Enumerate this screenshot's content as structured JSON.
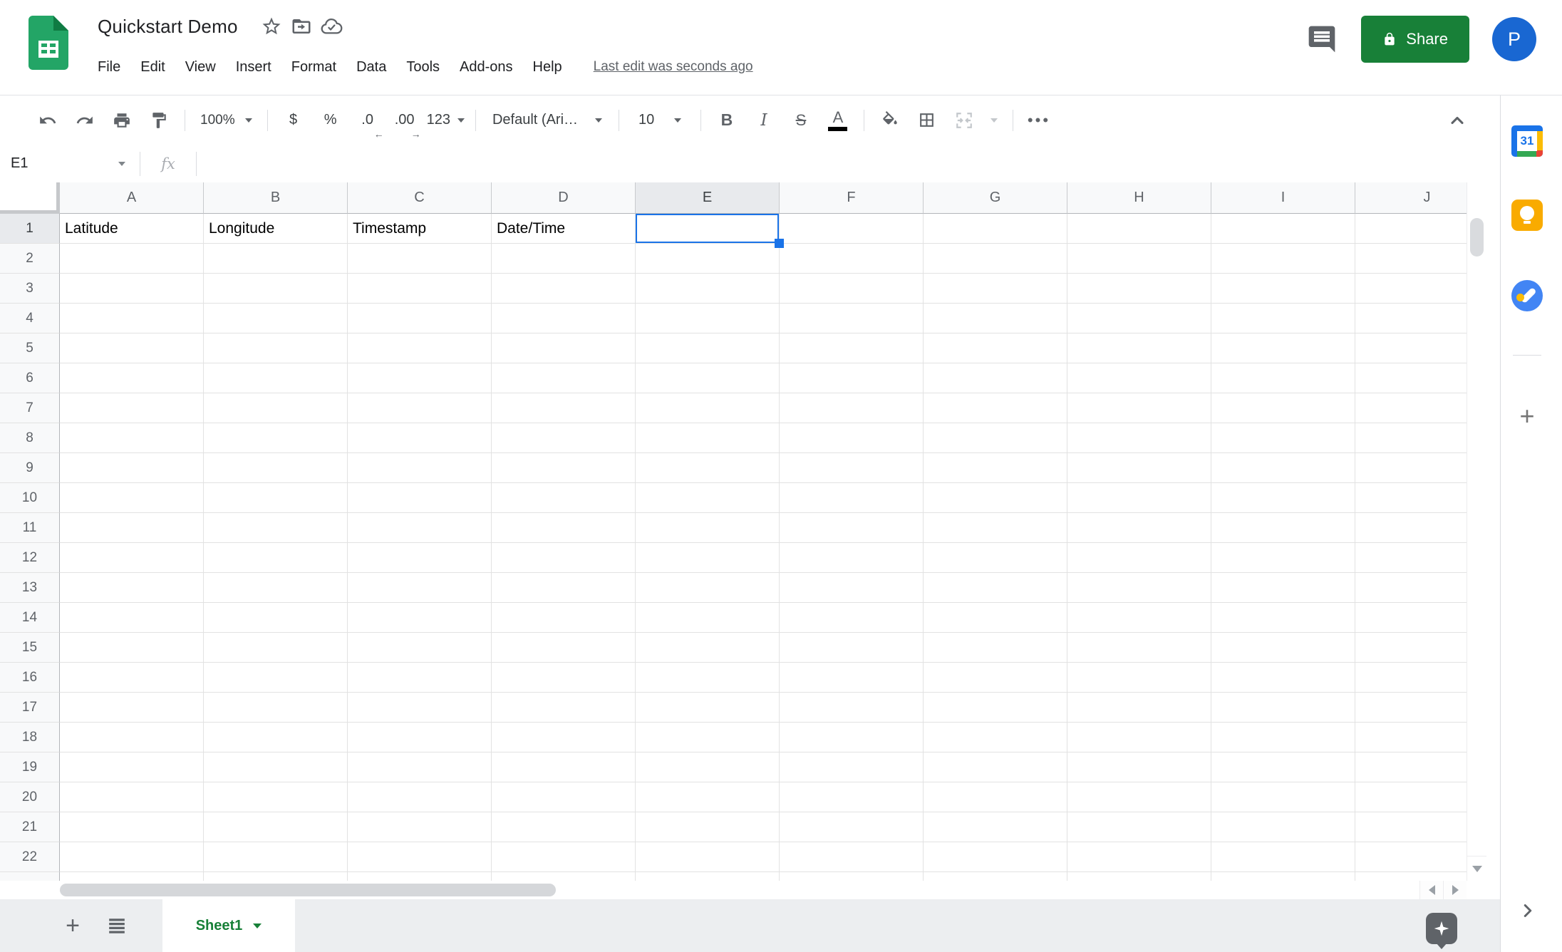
{
  "header": {
    "title": "Quickstart Demo",
    "menu": [
      "File",
      "Edit",
      "View",
      "Insert",
      "Format",
      "Data",
      "Tools",
      "Add-ons",
      "Help"
    ],
    "last_edit": "Last edit was seconds ago",
    "share_label": "Share",
    "avatar_initial": "P"
  },
  "toolbar": {
    "zoom": "100%",
    "currency": "$",
    "percent": "%",
    "decrease_decimal": ".0",
    "increase_decimal": ".00",
    "number_format": "123",
    "font_name": "Default (Ari…",
    "font_size": "10",
    "bold": "B",
    "italic": "I",
    "strikethrough": "S",
    "text_color": "A",
    "more": "•••"
  },
  "formula_bar": {
    "name_box": "E1",
    "fx_label": "fx",
    "value": ""
  },
  "grid": {
    "columns": [
      "A",
      "B",
      "C",
      "D",
      "E",
      "F",
      "G",
      "H",
      "I",
      "J"
    ],
    "visible_rows": 23,
    "last_full_row": 22,
    "cells": {
      "A1": "Latitude",
      "B1": "Longitude",
      "C1": "Timestamp",
      "D1": "Date/Time"
    },
    "selected_cell": "E1",
    "selected_column": "E",
    "selected_row": 1
  },
  "sheet_bar": {
    "active_sheet": "Sheet1"
  },
  "side_panel": {
    "calendar_label": "31"
  },
  "colors": {
    "share-green": "#188038",
    "sheet-green": "#188038",
    "selection-blue": "#1a73e8",
    "avatar-blue": "#1967d2",
    "keep-yellow": "#f9ab00",
    "tasks-blue": "#4285f4",
    "logo-green": "#23a566",
    "logo-fold": "#0f7b43"
  }
}
